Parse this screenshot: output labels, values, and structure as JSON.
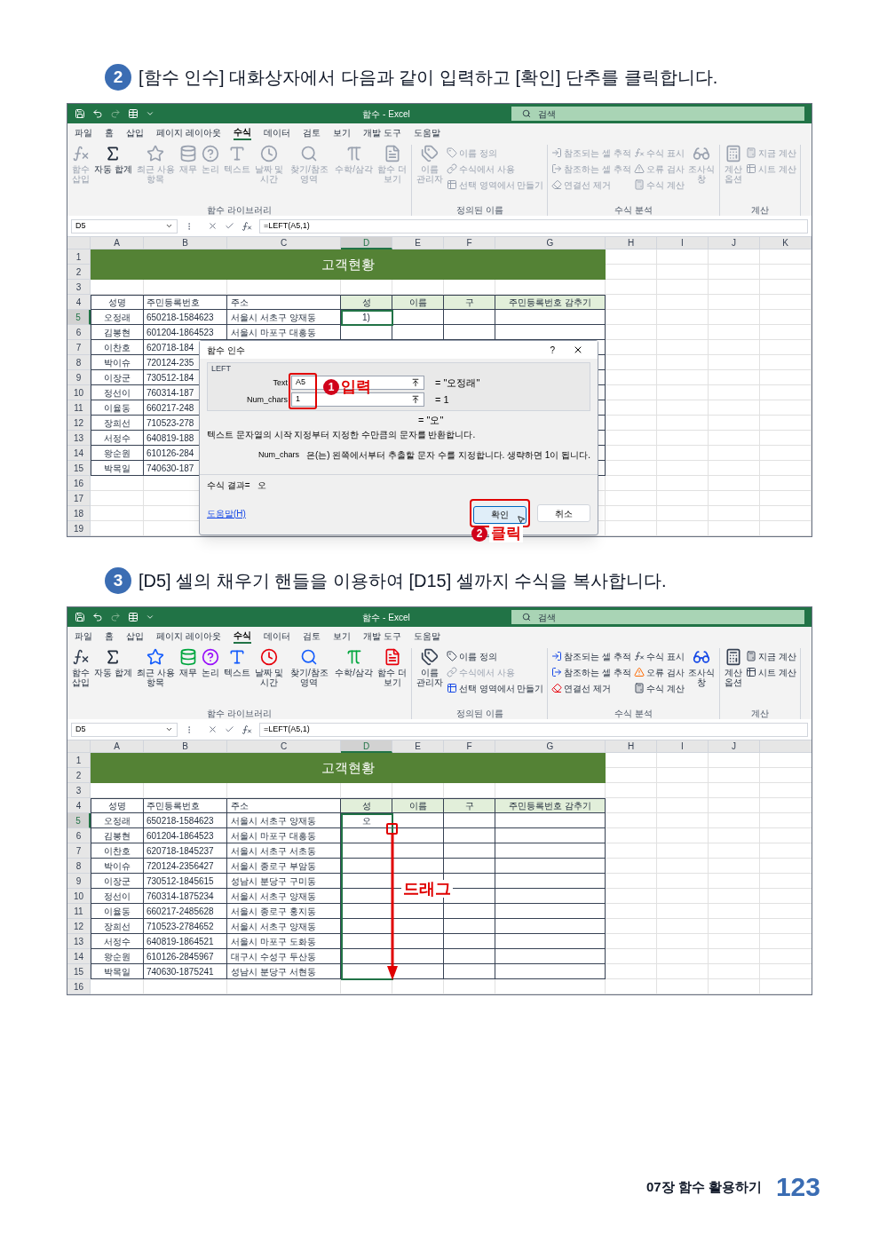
{
  "steps": [
    {
      "number": "2",
      "text": "[함수 인수] 대화상자에서 다음과 같이 입력하고 [확인] 단추를 클릭합니다.",
      "screenshot": {
        "title": "함수 - Excel",
        "search_placeholder": "검색",
        "menu": [
          {
            "label": "파일",
            "selected": false
          },
          {
            "label": "홈",
            "selected": false
          },
          {
            "label": "삽입",
            "selected": false
          },
          {
            "label": "페이지 레이아웃",
            "selected": false
          },
          {
            "label": "수식",
            "selected": true
          },
          {
            "label": "데이터",
            "selected": false
          },
          {
            "label": "검토",
            "selected": false
          },
          {
            "label": "보기",
            "selected": false
          },
          {
            "label": "개발 도구",
            "selected": false
          },
          {
            "label": "도움말",
            "selected": false
          }
        ],
        "ribbon": [
          {
            "label": "함수 라이브러리",
            "items": [
              {
                "kind": "big",
                "label": "함수\n삽입",
                "disabled": true
              },
              {
                "kind": "big",
                "label": "자동 합계",
                "disabled": false
              },
              {
                "kind": "big",
                "label": "최근 사용\n항목",
                "disabled": true
              },
              {
                "kind": "big",
                "label": "재무",
                "disabled": true
              },
              {
                "kind": "big",
                "label": "논리",
                "disabled": true
              },
              {
                "kind": "big",
                "label": "텍스트",
                "disabled": true
              },
              {
                "kind": "big",
                "label": "날짜 및\n시간",
                "disabled": true
              },
              {
                "kind": "big",
                "label": "찾기/참조 영역",
                "disabled": true
              },
              {
                "kind": "big",
                "label": "수학/삼각",
                "disabled": true
              },
              {
                "kind": "big",
                "label": "함수 더\n보기",
                "disabled": true
              }
            ]
          },
          {
            "label": "정의된 이름",
            "items": [
              {
                "kind": "big",
                "label": "이름\n관리자",
                "disabled": true
              },
              {
                "kind": "small",
                "label": "이름 정의",
                "disabled": true
              },
              {
                "kind": "small",
                "label": "수식에서 사용",
                "disabled": true
              },
              {
                "kind": "small",
                "label": "선택 영역에서 만들기",
                "disabled": true
              }
            ]
          },
          {
            "label": "수식 분석",
            "items": [
              {
                "kind": "small",
                "label": "참조되는 셀 추적",
                "disabled": true
              },
              {
                "kind": "small",
                "label": "참조하는 셀 추적",
                "disabled": true
              },
              {
                "kind": "small",
                "label": "연결선 제거",
                "disabled": true
              },
              {
                "kind": "small",
                "label": "수식 표시",
                "disabled": true
              },
              {
                "kind": "small",
                "label": "오류 검사",
                "disabled": true
              },
              {
                "kind": "small",
                "label": "수식 계산",
                "disabled": true
              },
              {
                "kind": "big",
                "label": "조사식\n창",
                "disabled": true
              }
            ]
          },
          {
            "label": "계산",
            "items": [
              {
                "kind": "big",
                "label": "계산\n옵션",
                "disabled": true
              },
              {
                "kind": "small",
                "label": "지금 계산",
                "disabled": true
              },
              {
                "kind": "small",
                "label": "시트 계산",
                "disabled": true
              }
            ]
          }
        ],
        "name_box": "D5",
        "formula": "=LEFT(A5,1)",
        "sheet": {
          "columns": [
            {
              "letter": "A",
              "selected": false
            },
            {
              "letter": "B",
              "selected": false
            },
            {
              "letter": "C",
              "selected": false
            },
            {
              "letter": "D",
              "selected": true
            },
            {
              "letter": "E",
              "selected": false
            },
            {
              "letter": "F",
              "selected": false
            },
            {
              "letter": "G",
              "selected": false
            },
            {
              "letter": "H",
              "selected": false
            },
            {
              "letter": "I",
              "selected": false
            },
            {
              "letter": "J",
              "selected": false
            },
            {
              "letter": "K",
              "selected": false
            }
          ],
          "rows": [
            {
              "number": "1",
              "selected": false
            },
            {
              "number": "2",
              "selected": false
            },
            {
              "number": "3",
              "selected": false
            },
            {
              "number": "4",
              "selected": false
            },
            {
              "number": "5",
              "selected": true
            },
            {
              "number": "6",
              "selected": false
            },
            {
              "number": "7",
              "selected": false
            },
            {
              "number": "8",
              "selected": false
            },
            {
              "number": "9",
              "selected": false
            },
            {
              "number": "10",
              "selected": false
            },
            {
              "number": "11",
              "selected": false
            },
            {
              "number": "12",
              "selected": false
            },
            {
              "number": "13",
              "selected": false
            },
            {
              "number": "14",
              "selected": false
            },
            {
              "number": "15",
              "selected": false
            },
            {
              "number": "16",
              "selected": false
            },
            {
              "number": "17",
              "selected": false
            },
            {
              "number": "18",
              "selected": false
            },
            {
              "number": "19",
              "selected": false
            }
          ],
          "banner": "고객현황",
          "header": [
            "성명",
            "주민등록번호",
            "주소",
            "성",
            "이름",
            "구",
            "주민등록번호 감추기"
          ],
          "records": [
            [
              "오정래",
              "650218-1584623",
              "서울시 서초구 양재동",
              "1)"
            ],
            [
              "김봉현",
              "601204-1864523",
              "서울시 마포구 대흥동"
            ],
            [
              "이찬호",
              "620718-184"
            ],
            [
              "박이슈",
              "720124-235"
            ],
            [
              "이장군",
              "730512-184"
            ],
            [
              "정선이",
              "760314-187"
            ],
            [
              "이율동",
              "660217-248"
            ],
            [
              "장희선",
              "710523-278"
            ],
            [
              "서정수",
              "640819-188"
            ],
            [
              "왕순원",
              "610126-284"
            ],
            [
              "박목일",
              "740630-187"
            ]
          ],
          "range_selected": false
        },
        "dialog": {
          "title": "함수 인수",
          "help": "?",
          "function": "LEFT",
          "args": [
            {
              "label": "Text",
              "value": "A5",
              "result": "= \"오정래\""
            },
            {
              "label": "Num_chars",
              "value": "1",
              "result": "= 1"
            }
          ],
          "result": "= \"오\"",
          "description": "텍스트 문자열의 시작 지정부터 지정한 수만큼의 문자를 반환합니다.",
          "arg_name": "Num_chars",
          "arg_help": "은(는) 왼쪽에서부터 추출할 문자 수를 지정합니다. 생략하면 1이 됩니다.",
          "result_label": "수식 결과=",
          "result_value": "오",
          "help_link": "도움말(H)",
          "buttons": [
            {
              "label": "확인",
              "default": true
            },
            {
              "label": "취소",
              "default": false
            }
          ],
          "input_callout": {
            "badge": "1",
            "text": "입력"
          },
          "ok_callout": {
            "badge": "2",
            "text": "클릭"
          }
        }
      }
    },
    {
      "number": "3",
      "text": "[D5] 셀의 채우기 핸들을 이용하여 [D15] 셀까지 수식을 복사합니다.",
      "screenshot": {
        "title": "함수 - Excel",
        "search_placeholder": "검색",
        "menu": [
          {
            "label": "파일",
            "selected": false
          },
          {
            "label": "홈",
            "selected": false
          },
          {
            "label": "삽입",
            "selected": false
          },
          {
            "label": "페이지 레이아웃",
            "selected": false
          },
          {
            "label": "수식",
            "selected": true
          },
          {
            "label": "데이터",
            "selected": false
          },
          {
            "label": "검토",
            "selected": false
          },
          {
            "label": "보기",
            "selected": false
          },
          {
            "label": "개발 도구",
            "selected": false
          },
          {
            "label": "도움말",
            "selected": false
          }
        ],
        "ribbon": [
          {
            "label": "함수 라이브러리",
            "items": [
              {
                "kind": "big",
                "label": "함수\n삽입",
                "disabled": false
              },
              {
                "kind": "big",
                "label": "자동 합계",
                "disabled": false
              },
              {
                "kind": "big",
                "label": "최근 사용\n항목",
                "disabled": false
              },
              {
                "kind": "big",
                "label": "재무",
                "disabled": false
              },
              {
                "kind": "big",
                "label": "논리",
                "disabled": false
              },
              {
                "kind": "big",
                "label": "텍스트",
                "disabled": false
              },
              {
                "kind": "big",
                "label": "날짜 및\n시간",
                "disabled": false
              },
              {
                "kind": "big",
                "label": "찾기/참조 영역",
                "disabled": false
              },
              {
                "kind": "big",
                "label": "수학/삼각",
                "disabled": false
              },
              {
                "kind": "big",
                "label": "함수 더\n보기",
                "disabled": false
              }
            ]
          },
          {
            "label": "정의된 이름",
            "items": [
              {
                "kind": "big",
                "label": "이름\n관리자",
                "disabled": false
              },
              {
                "kind": "small",
                "label": "이름 정의",
                "disabled": false
              },
              {
                "kind": "small",
                "label": "수식에서 사용",
                "disabled": true
              },
              {
                "kind": "small",
                "label": "선택 영역에서 만들기",
                "disabled": false
              }
            ]
          },
          {
            "label": "수식 분석",
            "items": [
              {
                "kind": "small",
                "label": "참조되는 셀 추적",
                "disabled": false
              },
              {
                "kind": "small",
                "label": "참조하는 셀 추적",
                "disabled": false
              },
              {
                "kind": "small",
                "label": "연결선 제거",
                "disabled": false
              },
              {
                "kind": "small",
                "label": "수식 표시",
                "disabled": false
              },
              {
                "kind": "small",
                "label": "오류 검사",
                "disabled": false
              },
              {
                "kind": "small",
                "label": "수식 계산",
                "disabled": false
              },
              {
                "kind": "big",
                "label": "조사식\n창",
                "disabled": false
              }
            ]
          },
          {
            "label": "계산",
            "items": [
              {
                "kind": "big",
                "label": "계산\n옵션",
                "disabled": false
              },
              {
                "kind": "small",
                "label": "지금 계산",
                "disabled": false
              },
              {
                "kind": "small",
                "label": "시트 계산",
                "disabled": false
              }
            ]
          }
        ],
        "name_box": "D5",
        "formula": "=LEFT(A5,1)",
        "sheet": {
          "columns": [
            {
              "letter": "A",
              "selected": false
            },
            {
              "letter": "B",
              "selected": false
            },
            {
              "letter": "C",
              "selected": false
            },
            {
              "letter": "D",
              "selected": true
            },
            {
              "letter": "E",
              "selected": false
            },
            {
              "letter": "F",
              "selected": false
            },
            {
              "letter": "G",
              "selected": false
            },
            {
              "letter": "H",
              "selected": false
            },
            {
              "letter": "I",
              "selected": false
            },
            {
              "letter": "J",
              "selected": false
            }
          ],
          "rows": [
            {
              "number": "1",
              "selected": false
            },
            {
              "number": "2",
              "selected": false
            },
            {
              "number": "3",
              "selected": false
            },
            {
              "number": "4",
              "selected": false
            },
            {
              "number": "5",
              "selected": true
            },
            {
              "number": "6",
              "selected": false
            },
            {
              "number": "7",
              "selected": false
            },
            {
              "number": "8",
              "selected": false
            },
            {
              "number": "9",
              "selected": false
            },
            {
              "number": "10",
              "selected": false
            },
            {
              "number": "11",
              "selected": false
            },
            {
              "number": "12",
              "selected": false
            },
            {
              "number": "13",
              "selected": false
            },
            {
              "number": "14",
              "selected": false
            },
            {
              "number": "15",
              "selected": false
            },
            {
              "number": "16",
              "selected": false
            }
          ],
          "banner": "고객현황",
          "header": [
            "성명",
            "주민등록번호",
            "주소",
            "성",
            "이름",
            "구",
            "주민등록번호 감추기"
          ],
          "records": [
            [
              "오정래",
              "650218-1584623",
              "서울시 서초구 양재동",
              "오"
            ],
            [
              "김봉현",
              "601204-1864523",
              "서울시 마포구 대흥동"
            ],
            [
              "이찬호",
              "620718-1845237",
              "서울시 서초구 서초동"
            ],
            [
              "박이슈",
              "720124-2356427",
              "서울시 종로구 부암동"
            ],
            [
              "이장군",
              "730512-1845615",
              "성남시 분당구 구미동"
            ],
            [
              "정선이",
              "760314-1875234",
              "서울시 서초구 양재동"
            ],
            [
              "이율동",
              "660217-2485628",
              "서울시 종로구 홍지동"
            ],
            [
              "장희선",
              "710523-2784652",
              "서울시 서초구 양재동"
            ],
            [
              "서정수",
              "640819-1864521",
              "서울시 마포구 도화동"
            ],
            [
              "왕순원",
              "610126-2845967",
              "대구시 수성구 두산동"
            ],
            [
              "박목일",
              "740630-1875241",
              "성남시 분당구 서현동"
            ]
          ],
          "range_selected": true,
          "drag_label": "드래그"
        }
      }
    }
  ],
  "footer": {
    "chapter": "07장 함수 활용하기",
    "page": "123"
  }
}
